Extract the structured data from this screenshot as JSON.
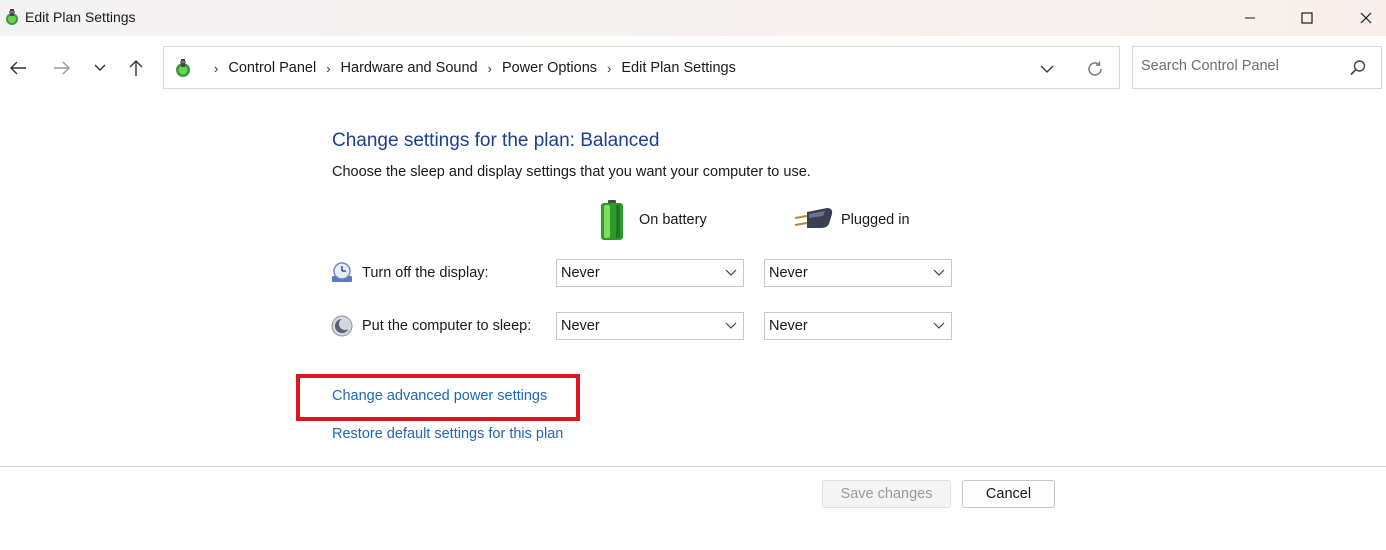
{
  "window": {
    "title": "Edit Plan Settings"
  },
  "addressbar": {
    "breadcrumbs": [
      "Control Panel",
      "Hardware and Sound",
      "Power Options",
      "Edit Plan Settings"
    ]
  },
  "search": {
    "placeholder": "Search Control Panel"
  },
  "main": {
    "title": "Change settings for the plan: Balanced",
    "description": "Choose the sleep and display settings that you want your computer to use.",
    "columns": {
      "battery": "On battery",
      "plugged": "Plugged in"
    },
    "rows": [
      {
        "label": "Turn off the display:",
        "battery_value": "Never",
        "plugged_value": "Never"
      },
      {
        "label": "Put the computer to sleep:",
        "battery_value": "Never",
        "plugged_value": "Never"
      }
    ],
    "links": {
      "advanced": "Change advanced power settings",
      "restore": "Restore default settings for this plan"
    }
  },
  "footer": {
    "save_label": "Save changes",
    "cancel_label": "Cancel"
  },
  "colors": {
    "title_blue": "#1e3e8f",
    "link_blue": "#1f67b5",
    "highlight_red": "#e0141e"
  },
  "icons": {
    "app": "power-options-icon",
    "battery": "battery-icon",
    "plug": "power-plug-icon",
    "display": "display-timer-icon",
    "sleep": "sleep-moon-icon"
  }
}
